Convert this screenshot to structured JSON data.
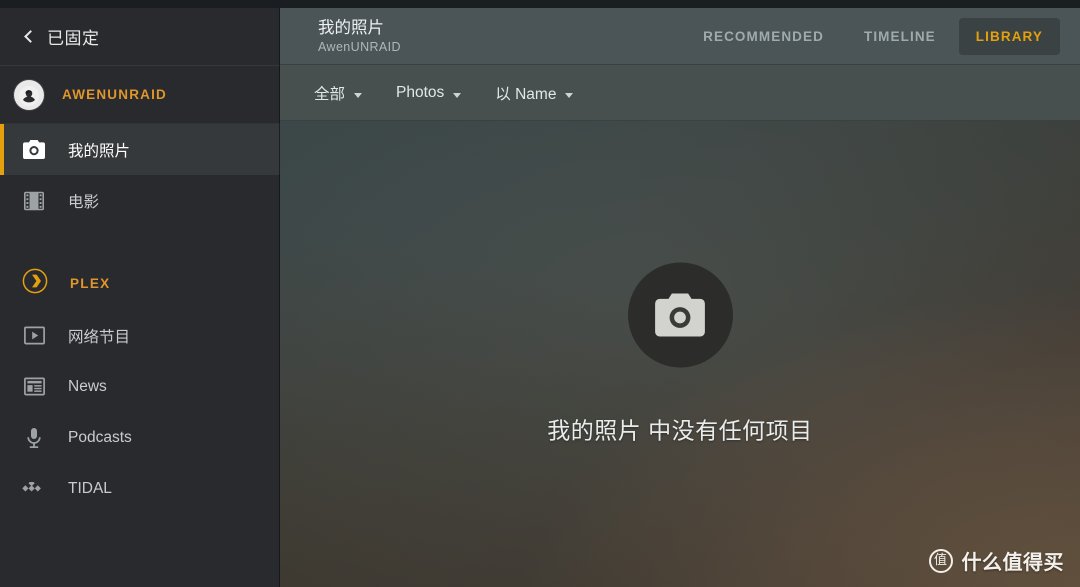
{
  "window": {
    "accent_color": "#e5a00d",
    "sidebar_bg": "#282a2d",
    "header_bg": "#4b5456"
  },
  "sidebar": {
    "back_label": "已固定",
    "back_icon": "chevron-left-icon",
    "user": {
      "name": "AWENUNRAID",
      "avatar_icon": "user-avatar"
    },
    "items": [
      {
        "label": "我的照片",
        "icon": "camera-icon",
        "active": true
      },
      {
        "label": "电影",
        "icon": "film-strip-icon",
        "active": false
      }
    ],
    "section": {
      "label": "PLEX",
      "icon": "plex-logo-icon"
    },
    "service_items": [
      {
        "label": "网络节目",
        "icon": "play-box-icon"
      },
      {
        "label": "News",
        "icon": "news-icon"
      },
      {
        "label": "Podcasts",
        "icon": "microphone-icon"
      },
      {
        "label": "TIDAL",
        "icon": "tidal-icon"
      }
    ]
  },
  "header": {
    "title": "我的照片",
    "subtitle": "AwenUNRAID",
    "tabs": [
      {
        "label": "RECOMMENDED",
        "active": false
      },
      {
        "label": "TIMELINE",
        "active": false
      },
      {
        "label": "LIBRARY",
        "active": true
      }
    ]
  },
  "filter_bar": {
    "filters": [
      {
        "label": "全部",
        "icon": "chevron-down-icon"
      },
      {
        "label": "Photos",
        "icon": "chevron-down-icon"
      },
      {
        "label": "以 Name",
        "icon": "chevron-down-icon"
      }
    ]
  },
  "main": {
    "empty_state": {
      "icon": "camera-icon",
      "message": "我的照片 中没有任何项目"
    }
  },
  "watermark": {
    "badge": "值",
    "text": "什么值得买"
  }
}
